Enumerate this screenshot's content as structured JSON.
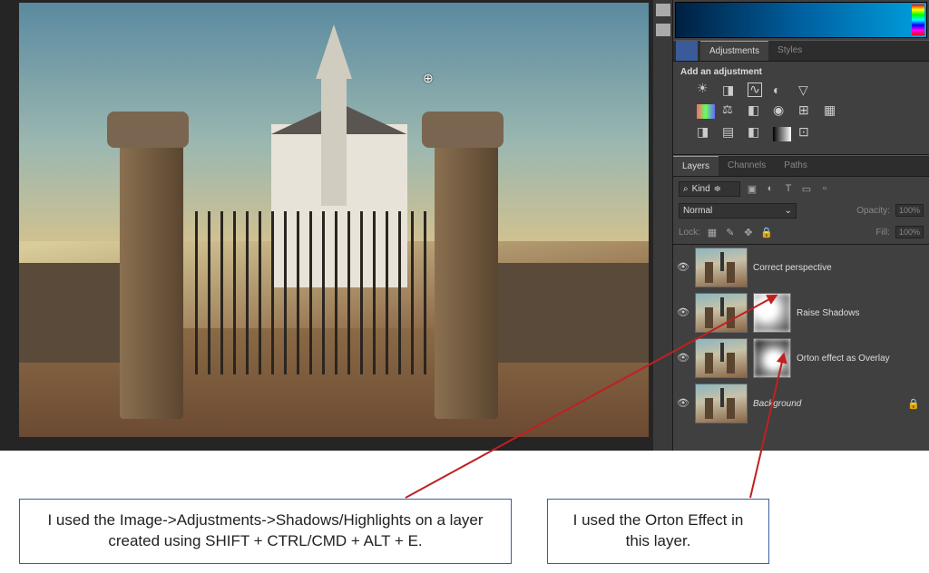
{
  "panels": {
    "adjustments": {
      "tab_adjustments": "Adjustments",
      "tab_styles": "Styles",
      "title": "Add an adjustment",
      "icons_row1": [
        "brightness",
        "levels",
        "curves",
        "exposure",
        "vibrance"
      ],
      "icons_row2": [
        "hue",
        "balance",
        "black-white",
        "photo-filter",
        "mixer",
        "lut"
      ],
      "icons_row3": [
        "invert",
        "posterize",
        "threshold",
        "gradient-map",
        "selective"
      ]
    },
    "layers": {
      "tab_layers": "Layers",
      "tab_channels": "Channels",
      "tab_paths": "Paths",
      "kind_label": "Kind",
      "kind_filters": [
        "image",
        "effects",
        "type",
        "shape",
        "smart"
      ],
      "blend_mode": "Normal",
      "opacity_label": "Opacity:",
      "opacity_value": "100%",
      "lock_label": "Lock:",
      "lock_icons": [
        "transparent",
        "image",
        "position",
        "all"
      ],
      "fill_label": "Fill:",
      "fill_value": "100%",
      "items": [
        {
          "name": "Correct perspective",
          "has_mask": false,
          "visible": true
        },
        {
          "name": "Raise Shadows",
          "has_mask": true,
          "mask_style": "blur1",
          "visible": true
        },
        {
          "name": "Orton effect as Overlay",
          "has_mask": true,
          "mask_style": "blur2",
          "visible": true
        },
        {
          "name": "Background",
          "has_mask": false,
          "visible": true,
          "italic": true,
          "locked": true
        }
      ]
    }
  },
  "annotations": {
    "a1": "I used the Image->Adjustments->Shadows/Highlights on a layer created using SHIFT + CTRL/CMD + ALT + E.",
    "a2": "I used the Orton Effect in this layer."
  },
  "canvas_cursor": "⊕"
}
